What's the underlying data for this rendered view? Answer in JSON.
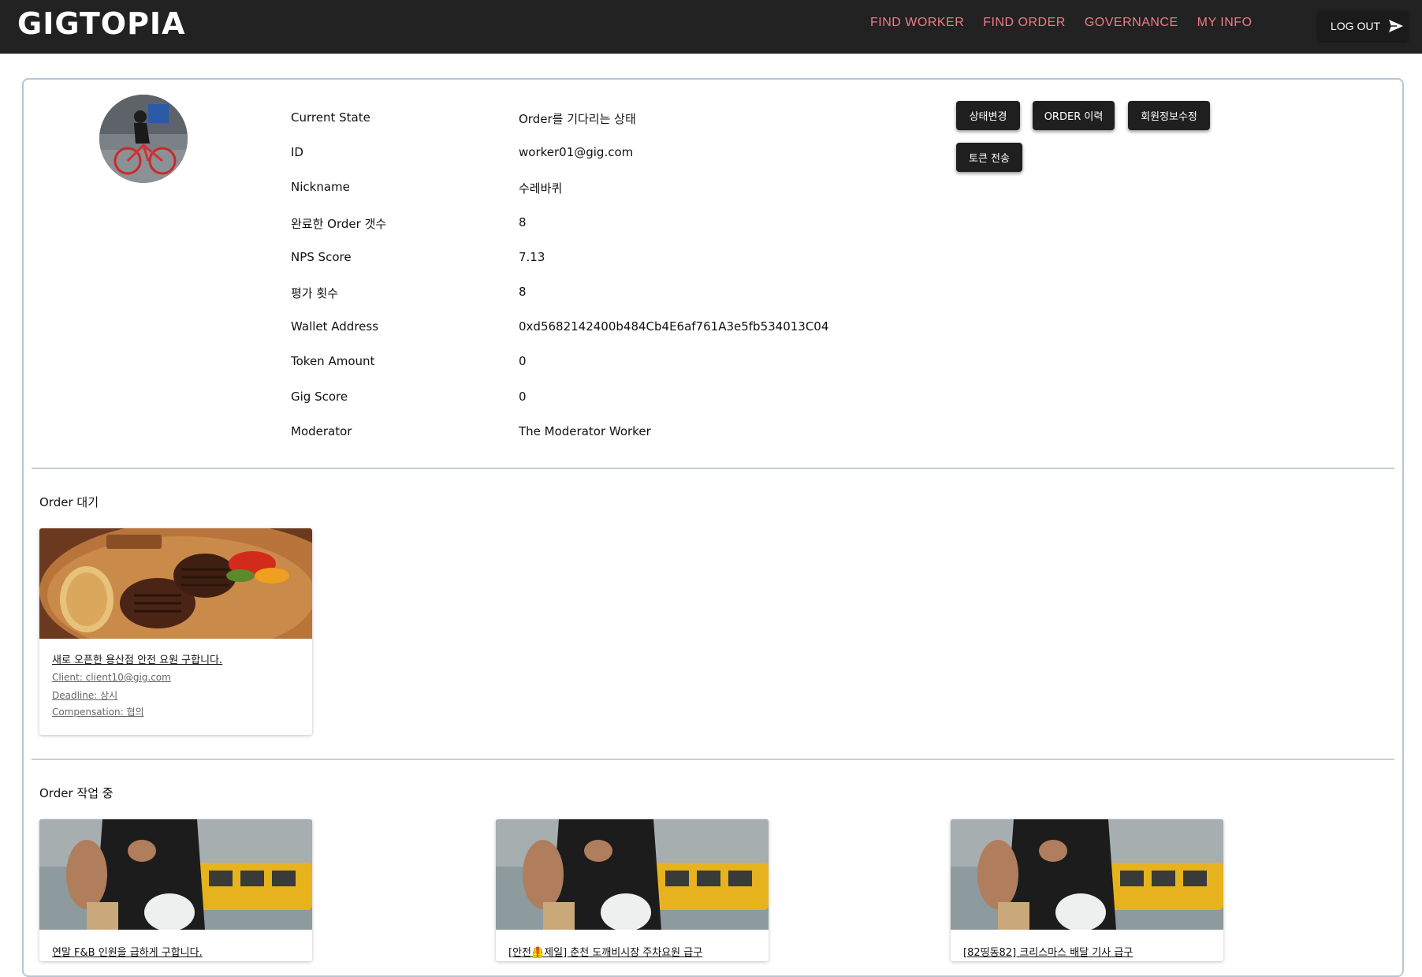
{
  "header": {
    "logo": "GIGTOPIA",
    "nav": [
      "FIND WORKER",
      "FIND ORDER",
      "GOVERNANCE",
      "MY INFO"
    ],
    "logout_label": "LOG OUT",
    "logout_icon": "send-icon"
  },
  "profile": {
    "rows": [
      {
        "label": "Current State",
        "value": "Order를 기다리는 상태"
      },
      {
        "label": "ID",
        "value": "worker01@gig.com"
      },
      {
        "label": "Nickname",
        "value": "수레바퀴"
      },
      {
        "label": "완료한 Order 갯수",
        "value": "8"
      },
      {
        "label": "NPS Score",
        "value": "7.13"
      },
      {
        "label": "평가 횟수",
        "value": "8"
      },
      {
        "label": "Wallet Address",
        "value": "0xd5682142400b484Cb4E6af761A3e5fb534013C04"
      },
      {
        "label": "Token Amount",
        "value": "0"
      },
      {
        "label": "Gig Score",
        "value": "0"
      },
      {
        "label": "Moderator",
        "value": "The Moderator Worker"
      }
    ],
    "buttons": {
      "change_state": "상태변경",
      "order_history": "ORDER 이력",
      "edit_info": "회원정보수정",
      "send_token": "토큰 전송"
    }
  },
  "waiting": {
    "title": "Order 대기",
    "orders": [
      {
        "title": "새로 오픈한 용산점 안전 요원 구합니다.",
        "client": "Client: client10@gig.com",
        "deadline": "Deadline: 상시",
        "compensation": "Compensation: 협의"
      }
    ]
  },
  "working": {
    "title": "Order 작업 중",
    "orders": [
      {
        "title": "연말 F&B 인원을 급하게 구합니다."
      },
      {
        "title": "[안전🦺제일] 춘천 도깨비시장 주차요원 급구"
      },
      {
        "title": "[82띵동82] 크리스마스 배달 기사 급구"
      }
    ]
  },
  "colors": {
    "header_bg": "#222222",
    "nav_link": "#f07c8a",
    "button_bg": "#1f1f1f",
    "card_border": "#b8c6d2"
  }
}
